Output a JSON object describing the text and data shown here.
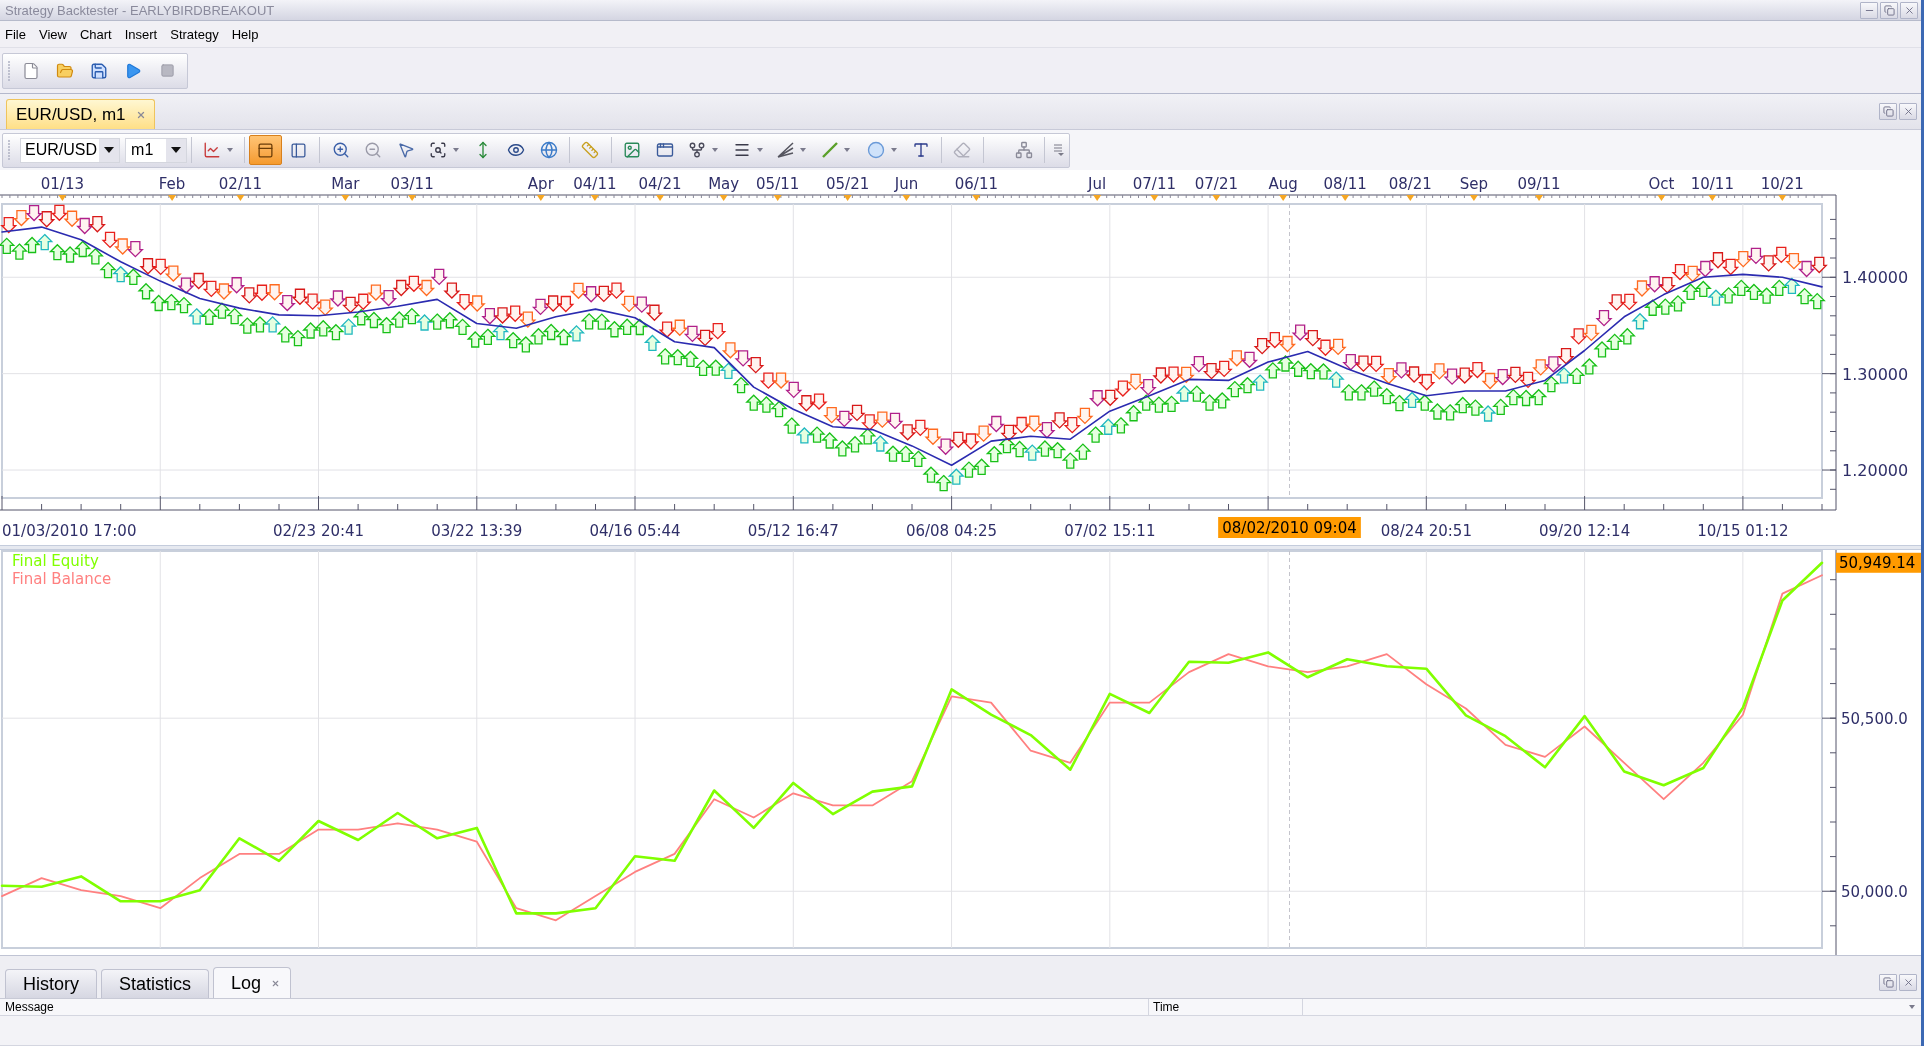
{
  "window": {
    "title": "Strategy Backtester - EARLYBIRDBREAKOUT"
  },
  "menu": [
    "File",
    "View",
    "Chart",
    "Insert",
    "Strategy",
    "Help"
  ],
  "document_tabs": [
    {
      "label": "EUR/USD, m1",
      "selected": true
    }
  ],
  "chart_toolbar": {
    "symbol": "EUR/USD",
    "timeframe": "m1",
    "view_toggles": [
      {
        "selected": true
      },
      {
        "selected": false
      }
    ]
  },
  "price_chart": {
    "date_scale": [
      "01/13",
      "Feb",
      "02/11",
      "Mar",
      "03/11",
      "Apr",
      "04/11",
      "04/21",
      "May",
      "05/11",
      "05/21",
      "Jun",
      "06/11",
      "Jul",
      "07/11",
      "07/21",
      "Aug",
      "08/11",
      "08/21",
      "Sep",
      "09/11",
      "Oct",
      "10/11",
      "10/21"
    ],
    "start_label": "01/03/2010 17:00",
    "crosshair": {
      "label": "08/02/2010 09:04"
    },
    "chart_data": {
      "type": "line",
      "grid": true,
      "categories": [
        null,
        null,
        null,
        null,
        null,
        null,
        null,
        null,
        "02/23 20:41",
        null,
        null,
        null,
        "03/22 13:39",
        null,
        null,
        null,
        "04/16 05:44",
        null,
        null,
        null,
        "05/12 16:47",
        null,
        null,
        null,
        "06/08 04:25",
        null,
        null,
        null,
        "07/02 15:11",
        null,
        null,
        null,
        null,
        null,
        null,
        null,
        "08/24 20:51",
        null,
        null,
        null,
        "09/20 12:14",
        null,
        null,
        null,
        "10/15 01:12",
        null,
        null
      ],
      "series": [
        {
          "color": "#2b2bb0",
          "values": [
            1.447,
            1.452,
            1.439,
            1.416,
            1.396,
            1.378,
            1.368,
            1.361,
            1.36,
            1.364,
            1.37,
            1.377,
            1.352,
            1.347,
            1.359,
            1.367,
            1.358,
            1.333,
            1.327,
            1.286,
            1.263,
            1.245,
            1.242,
            1.225,
            1.205,
            1.23,
            1.235,
            1.232,
            1.261,
            1.277,
            1.294,
            1.293,
            1.312,
            1.323,
            1.305,
            1.29,
            1.277,
            1.282,
            1.282,
            1.293,
            1.324,
            1.359,
            1.382,
            1.4,
            1.403,
            1.4,
            1.39
          ]
        }
      ],
      "ylim": [
        1.171,
        1.476
      ],
      "yticks": [
        {
          "value": 1.4,
          "label": "1.40000"
        },
        {
          "value": 1.3,
          "label": "1.30000"
        },
        {
          "value": 1.2,
          "label": "1.20000"
        }
      ]
    }
  },
  "equity_chart": {
    "last_value": "50,949.14",
    "chart_data": {
      "type": "line",
      "grid": true,
      "categories": [
        null,
        null,
        null,
        null,
        null,
        null,
        null,
        null,
        null,
        null,
        null,
        null,
        null,
        null,
        null,
        null,
        null,
        null,
        null,
        null,
        null,
        null,
        null,
        null,
        null,
        null,
        null,
        null,
        null,
        null,
        null,
        null,
        null,
        null,
        null,
        null,
        null,
        null,
        null,
        null,
        null,
        null,
        null,
        null,
        null,
        null,
        null
      ],
      "series": [
        {
          "name": "Final Equity",
          "color": "#80ff00",
          "values": [
            50016,
            50013,
            50043,
            49971,
            49971,
            50003,
            50153,
            50088,
            50203,
            50148,
            50226,
            50153,
            50183,
            49936,
            49936,
            49951,
            50101,
            50088,
            50291,
            50183,
            50313,
            50223,
            50288,
            50303,
            50583,
            50510,
            50451,
            50351,
            50570,
            50515,
            50663,
            50660,
            50690,
            50618,
            50670,
            50650,
            50643,
            50508,
            50448,
            50358,
            50506,
            50346,
            50306,
            50356,
            50530,
            50840,
            50949
          ]
        },
        {
          "name": "Final Balance",
          "color": "#ff8080",
          "values": [
            49986,
            50038,
            50003,
            49986,
            49951,
            50038,
            50108,
            50108,
            50178,
            50178,
            50196,
            50178,
            50143,
            49951,
            49916,
            49986,
            50056,
            50108,
            50266,
            50213,
            50283,
            50248,
            50248,
            50318,
            50563,
            50545,
            50406,
            50371,
            50545,
            50545,
            50633,
            50685,
            50650,
            50633,
            50650,
            50685,
            50598,
            50528,
            50423,
            50388,
            50476,
            50371,
            50266,
            50371,
            50510,
            50860,
            50913
          ]
        }
      ],
      "ylim": [
        49836,
        50983
      ],
      "yticks": [
        {
          "value": 50500,
          "label": "50,500.0"
        },
        {
          "value": 50000,
          "label": "50,000.0"
        }
      ]
    }
  },
  "bottom_panel": {
    "tabs": [
      {
        "label": "History",
        "selected": false,
        "closable": false
      },
      {
        "label": "Statistics",
        "selected": false,
        "closable": false
      },
      {
        "label": "Log",
        "selected": true,
        "closable": true
      }
    ],
    "columns": [
      "Message",
      "Time"
    ]
  }
}
